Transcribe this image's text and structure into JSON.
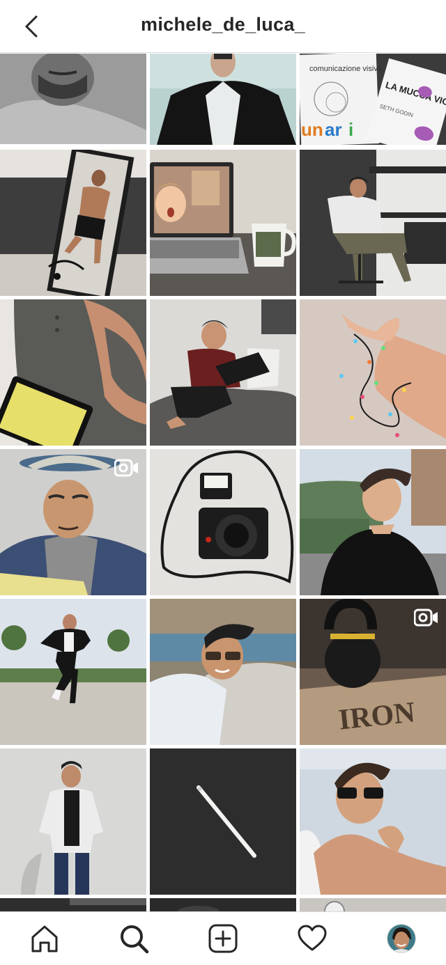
{
  "header": {
    "username": "michele_de_luca_"
  },
  "grid": {
    "posts": [
      {
        "subject": "man-selfie-bw",
        "badge": null
      },
      {
        "subject": "man-black-coat",
        "badge": null
      },
      {
        "subject": "books",
        "badge": null,
        "book_titles": [
          "comunicazione visiva",
          "LA MUCCA VIOLA",
          "SETH GODIN"
        ]
      },
      {
        "subject": "mirror-selfie",
        "badge": null
      },
      {
        "subject": "laptop-mug",
        "badge": null
      },
      {
        "subject": "man-desk-chair",
        "badge": null
      },
      {
        "subject": "grey-tshirt-tablet",
        "badge": null
      },
      {
        "subject": "man-laptop-bed",
        "badge": null
      },
      {
        "subject": "fairy-lights-hand",
        "badge": null
      },
      {
        "subject": "man-hat",
        "badge": "video"
      },
      {
        "subject": "camera",
        "badge": null
      },
      {
        "subject": "man-outdoor",
        "badge": null
      },
      {
        "subject": "man-dancing",
        "badge": null
      },
      {
        "subject": "man-sunglasses-rocks",
        "badge": null
      },
      {
        "subject": "kettlebell",
        "badge": "video",
        "overlay_text": "IRON"
      },
      {
        "subject": "man-white-shirt",
        "badge": null
      },
      {
        "subject": "pencil",
        "badge": null
      },
      {
        "subject": "man-shirtless-sunglasses",
        "badge": null
      }
    ]
  },
  "bottom_nav": {
    "items": [
      "home-icon",
      "search-icon",
      "new-post-icon",
      "activity-icon",
      "profile-avatar"
    ],
    "active": "search-icon"
  },
  "colors": {
    "border": "#dbdbdb",
    "text": "#262626",
    "background": "#ffffff"
  }
}
